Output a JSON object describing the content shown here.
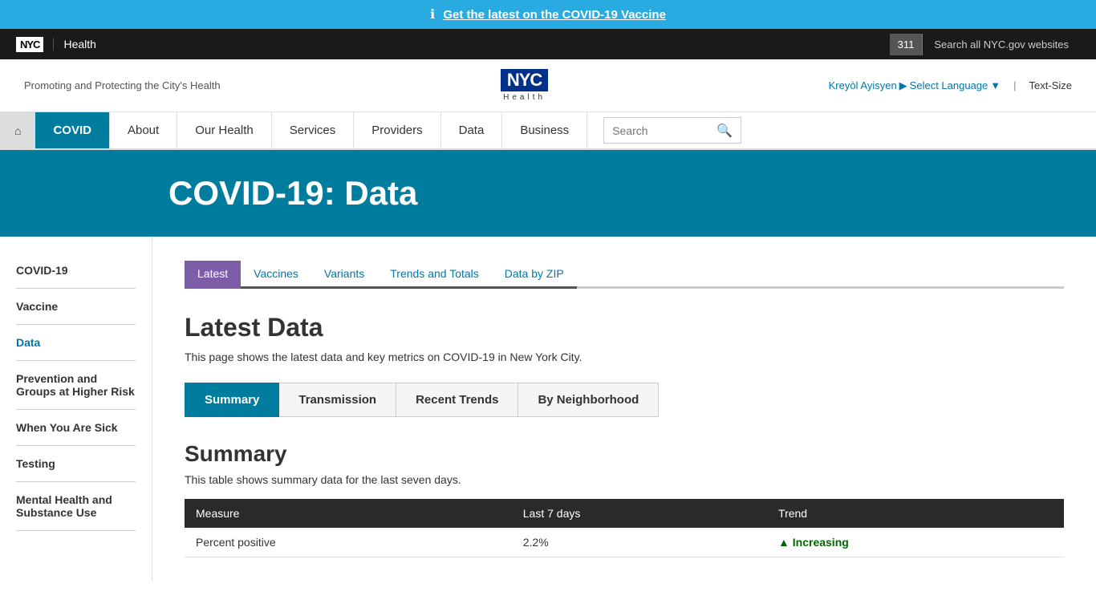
{
  "alert": {
    "icon": "ℹ",
    "text": "Get the latest on the COVID-19 Vaccine",
    "href": "#"
  },
  "topbar": {
    "logo": "NYC",
    "department": "Health",
    "phone": "311",
    "search_all": "Search all NYC.gov websites"
  },
  "header": {
    "tagline": "Promoting and Protecting the City's Health",
    "logo_text": "NYC",
    "logo_sub": "Health",
    "language": "Kreyòl Ayisyen",
    "select_language": "Select Language",
    "text_size": "Text-Size"
  },
  "nav": {
    "home_icon": "⌂",
    "items": [
      {
        "label": "COVID",
        "active": true
      },
      {
        "label": "About",
        "active": false
      },
      {
        "label": "Our Health",
        "active": false
      },
      {
        "label": "Services",
        "active": false
      },
      {
        "label": "Providers",
        "active": false
      },
      {
        "label": "Data",
        "active": false
      },
      {
        "label": "Business",
        "active": false
      }
    ],
    "search_placeholder": "Search"
  },
  "hero": {
    "title": "COVID-19: Data"
  },
  "sidebar": {
    "items": [
      {
        "label": "COVID-19",
        "active": false,
        "link": true
      },
      {
        "label": "Vaccine",
        "active": false,
        "link": false
      },
      {
        "label": "Data",
        "active": true,
        "link": true
      },
      {
        "label": "Prevention and Groups at Higher Risk",
        "active": false,
        "link": false
      },
      {
        "label": "When You Are Sick",
        "active": false,
        "link": false
      },
      {
        "label": "Testing",
        "active": false,
        "link": false
      },
      {
        "label": "Mental Health and Substance Use",
        "active": false,
        "link": false
      }
    ]
  },
  "content": {
    "data_tabs": [
      {
        "label": "Latest",
        "active": true
      },
      {
        "label": "Vaccines",
        "active": false
      },
      {
        "label": "Variants",
        "active": false
      },
      {
        "label": "Trends and Totals",
        "active": false
      },
      {
        "label": "Data by ZIP",
        "active": false
      }
    ],
    "page_heading": "Latest Data",
    "page_description": "This page shows the latest data and key metrics on COVID-19 in New York City.",
    "sub_tabs": [
      {
        "label": "Summary",
        "active": true
      },
      {
        "label": "Transmission",
        "active": false
      },
      {
        "label": "Recent Trends",
        "active": false
      },
      {
        "label": "By Neighborhood",
        "active": false
      }
    ],
    "summary_heading": "Summary",
    "summary_description": "This table shows summary data for the last seven days.",
    "table": {
      "headers": [
        "Measure",
        "Last 7 days",
        "Trend"
      ],
      "rows": [
        {
          "measure": "Percent positive",
          "last7": "2.2%",
          "trend": "▲ Increasing"
        }
      ]
    }
  }
}
